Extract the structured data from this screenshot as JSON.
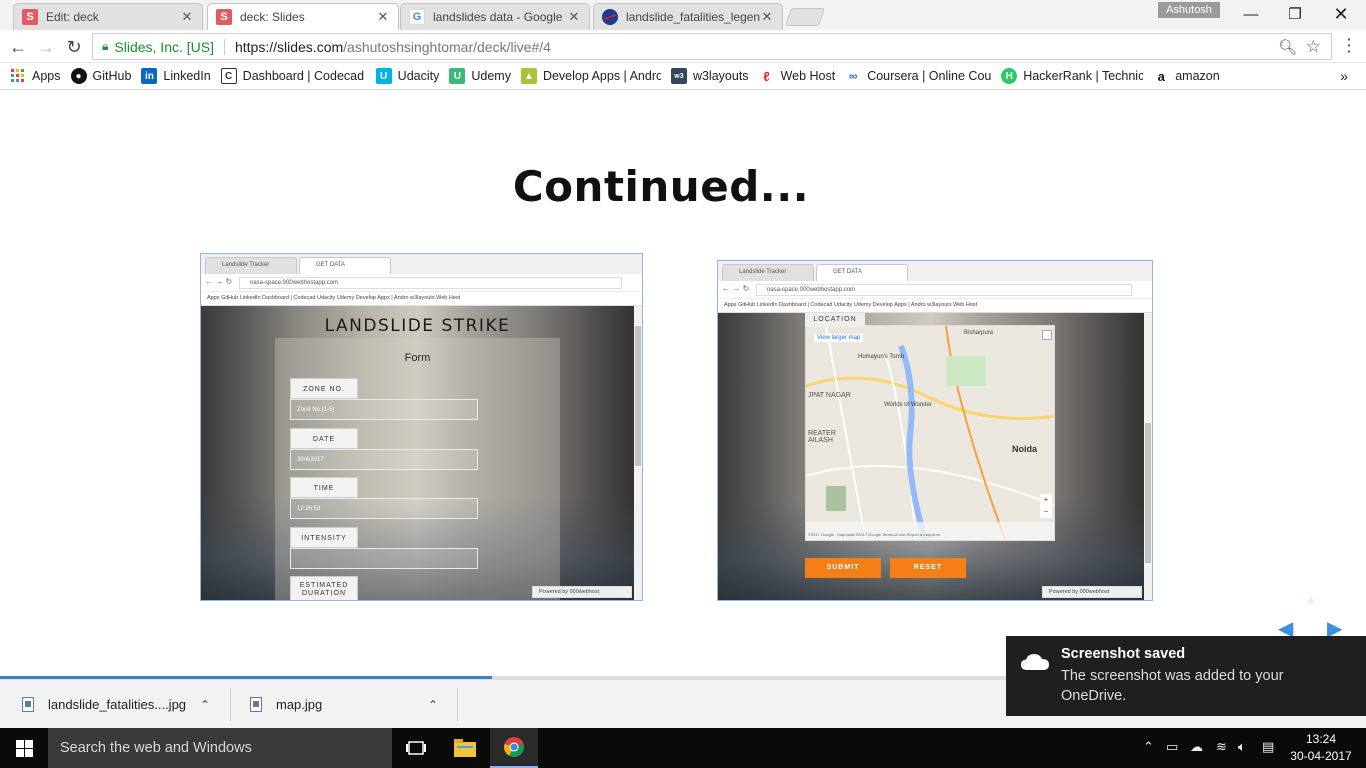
{
  "browser": {
    "tabs": [
      {
        "label": "Edit: deck",
        "favicon": "S",
        "favicon_color": "#e15b64"
      },
      {
        "label": "deck: Slides",
        "favicon": "S",
        "favicon_color": "#e15b64"
      },
      {
        "label": "landslides data - Google",
        "favicon": "G"
      },
      {
        "label": "landslide_fatalities_legen",
        "favicon": "NASA"
      }
    ],
    "profile_name": "Ashutosh",
    "omnibox": {
      "security_label": "Slides, Inc. [US]",
      "url_host": "https://slides.com",
      "url_path": "/ashutoshsinghtomar/deck/live#/4"
    },
    "bookmarks": [
      {
        "label": "Apps"
      },
      {
        "label": "GitHub"
      },
      {
        "label": "LinkedIn"
      },
      {
        "label": "Dashboard | Codecad"
      },
      {
        "label": "Udacity"
      },
      {
        "label": "Udemy"
      },
      {
        "label": "Develop Apps | Andro"
      },
      {
        "label": "w3layouts"
      },
      {
        "label": "Web Host"
      },
      {
        "label": "Coursera | Online Cou"
      },
      {
        "label": "HackerRank | Technica"
      },
      {
        "label": "amazon"
      }
    ],
    "bookmarks_more": "»"
  },
  "slide": {
    "title": "Continued...",
    "left_shot": {
      "tabs": [
        "Landslide Tracker",
        "GET DATA"
      ],
      "url": "nasa-space.000webhostapp.com",
      "bookmarks": "Apps  GitHub  LinkedIn  Dashboard | Codecad  Udacity  Udemy  Develop Apps | Andro  w3layouts  Web Host",
      "heading": "LANDSLIDE STRIKE",
      "subheading": "Form",
      "fields": [
        {
          "label": "ZONE NO.",
          "value": "Zone No.(1-5)"
        },
        {
          "label": "DATE",
          "value": "30/4/2017"
        },
        {
          "label": "TIME",
          "value": "12:26:53"
        },
        {
          "label": "INTENSITY",
          "value": ""
        },
        {
          "label": "ESTIMATED DURATION",
          "value": ""
        }
      ],
      "powered": "Powered by  000webhost"
    },
    "right_shot": {
      "tabs": [
        "Landslide Tracker",
        "GET DATA"
      ],
      "url": "nasa-space.000webhostapp.com",
      "bookmarks": "Apps  GitHub  LinkedIn  Dashboard | Codecad  Udacity  Udemy  Develop Apps | Andro  w3layouts  Web Host",
      "location_label": "LOCATION",
      "map_link": "View larger map",
      "map_places": [
        "Bisharpura",
        "Humayun's Tomb",
        "Worlds of Wonder",
        "JPAT NAGAR",
        "REATER AILASH",
        "Noida"
      ],
      "map_footer": "©2017 Google · Map data ©2017 Google   Terms of Use   Report a map error",
      "submit": "SUBMIT",
      "reset": "RESET",
      "powered": "Powered by  000webhost"
    }
  },
  "downloads": [
    {
      "name": "landslide_fatalities....jpg"
    },
    {
      "name": "map.jpg"
    }
  ],
  "toast": {
    "title": "Screenshot saved",
    "body": "The screenshot was added to your OneDrive."
  },
  "taskbar": {
    "search_placeholder": "Search the web and Windows",
    "time": "13:24",
    "date": "30-04-2017"
  },
  "progress_fraction": 0.36,
  "colors": {
    "accent": "#3d7ec7",
    "brand_orange": "#f57f17",
    "secure_green": "#1a8f2c"
  }
}
